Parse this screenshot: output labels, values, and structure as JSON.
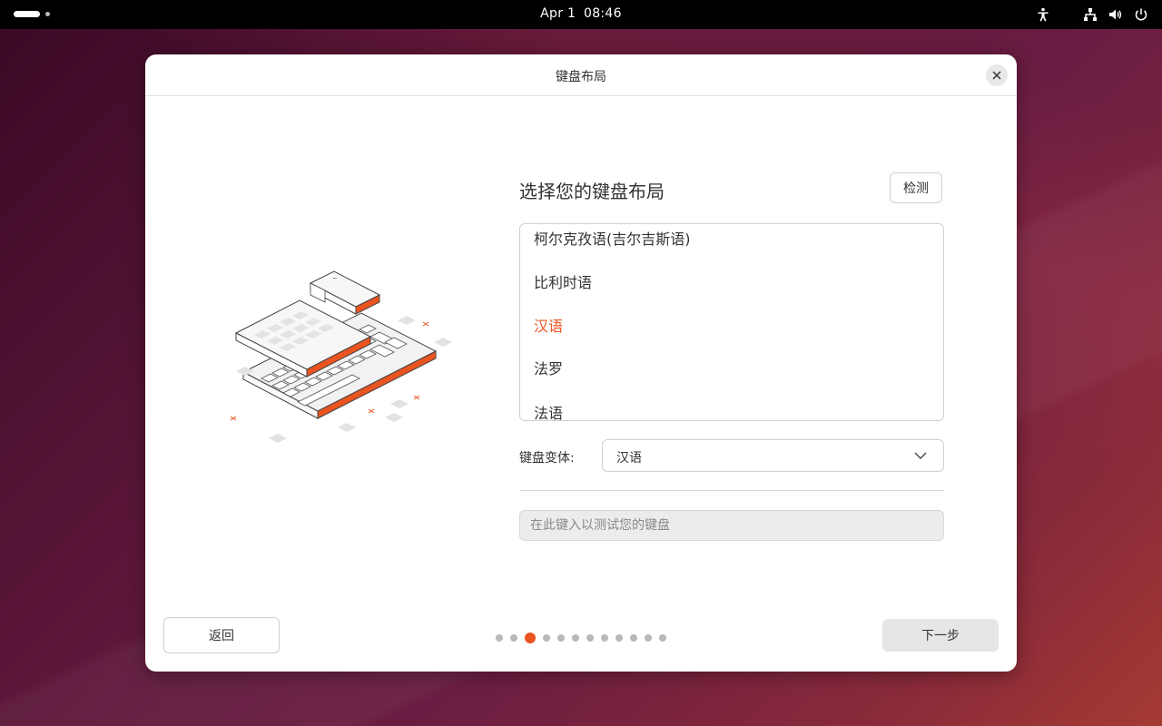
{
  "topbar": {
    "date": "Apr 1",
    "time": "08:46",
    "tray_icons": [
      "accessibility-icon",
      "network-icon",
      "volume-icon",
      "power-icon"
    ]
  },
  "dialog": {
    "title": "键盘布局",
    "heading": "选择您的键盘布局",
    "detect_label": "检测",
    "layouts": [
      {
        "label": "柯尔克孜语(吉尔吉斯语)",
        "selected": false
      },
      {
        "label": "比利时语",
        "selected": false
      },
      {
        "label": "汉语",
        "selected": true
      },
      {
        "label": "法罗",
        "selected": false
      },
      {
        "label": "法语",
        "selected": false
      }
    ],
    "variant_label": "键盘变体:",
    "variant_value": "汉语",
    "test_placeholder": "在此键入以测试您的键盘",
    "back_label": "返回",
    "next_label": "下一步",
    "steps_total": 12,
    "steps_current": 3
  },
  "colors": {
    "accent": "#e95420",
    "topbar": "#000000",
    "dialog_bg": "#ffffff"
  }
}
